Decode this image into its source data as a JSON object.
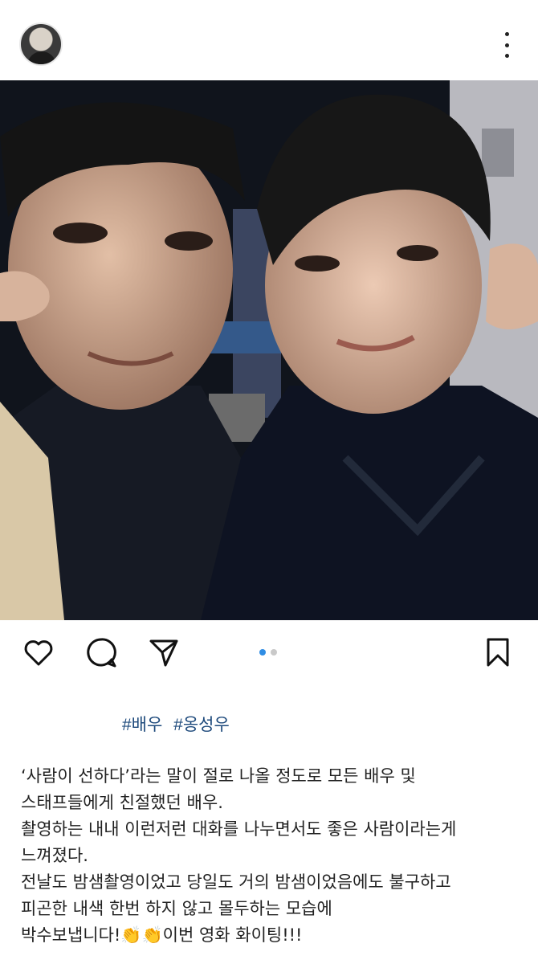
{
  "header": {
    "avatar_icon": "profile-avatar",
    "more_icon": "more-vertical-icon"
  },
  "photo": {
    "alt_colors": {
      "sky": "#2b3242",
      "jacket": "#0f1626",
      "skin": "#c9a58e"
    }
  },
  "actions": {
    "like_icon": "heart-icon",
    "comment_icon": "comment-icon",
    "share_icon": "share-icon",
    "save_icon": "bookmark-icon",
    "carousel": {
      "count": 2,
      "active": 1
    },
    "accent": "#2f8de4"
  },
  "hashtags": [
    "#배우",
    "#옹성우"
  ],
  "caption": [
    "‘사람이 선하다’라는 말이 절로 나올 정도로 모든 배우 및",
    "스태프들에게 친절했던 배우.",
    "촬영하는 내내 이런저런 대화를 나누면서도 좋은 사람이라는게",
    "느껴졌다.",
    "전날도 밤샘촬영이었고 당일도 거의 밤샘이었음에도 불구하고",
    "피곤한 내색 한번 하지 않고 몰두하는 모습에",
    "박수보냅니다!👏👏이번 영화 화이팅!!!"
  ]
}
